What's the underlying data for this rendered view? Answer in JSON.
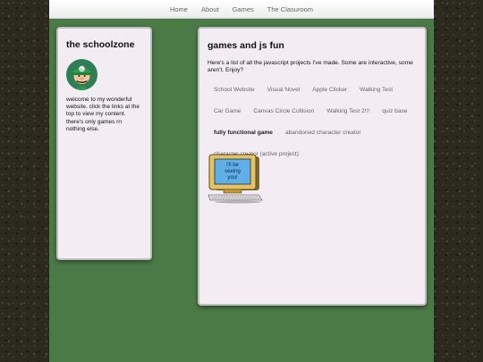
{
  "nav": {
    "items": [
      "Home",
      "About",
      "Games",
      "The Clasuroom"
    ]
  },
  "sidebar": {
    "title": "the schoolzone",
    "avatar_icon": "luigi-avatar-icon",
    "bio": "welcome to my wonderful website. click the links at the top to view my content. there's only games rn nothing else."
  },
  "content": {
    "title": "games and js fun",
    "intro": "Here's a list of all the javascript projects I've made. Some are interactive, some aren't. Enjoy?",
    "links": [
      "School Website",
      "Visual Novel",
      "Apple Clicker",
      "Walking Test",
      "Car Game",
      "Canvas Circle Collision",
      "Walking Test 2!!!",
      "quiz base",
      "fully functional game",
      "abandoned character creator",
      "character creator (active project)"
    ],
    "active_index": 8,
    "computer_screen_text": "I'll be seeing you!"
  },
  "colors": {
    "background": "#4a7a46",
    "panel": "#f3edf3",
    "link": "#666666"
  }
}
